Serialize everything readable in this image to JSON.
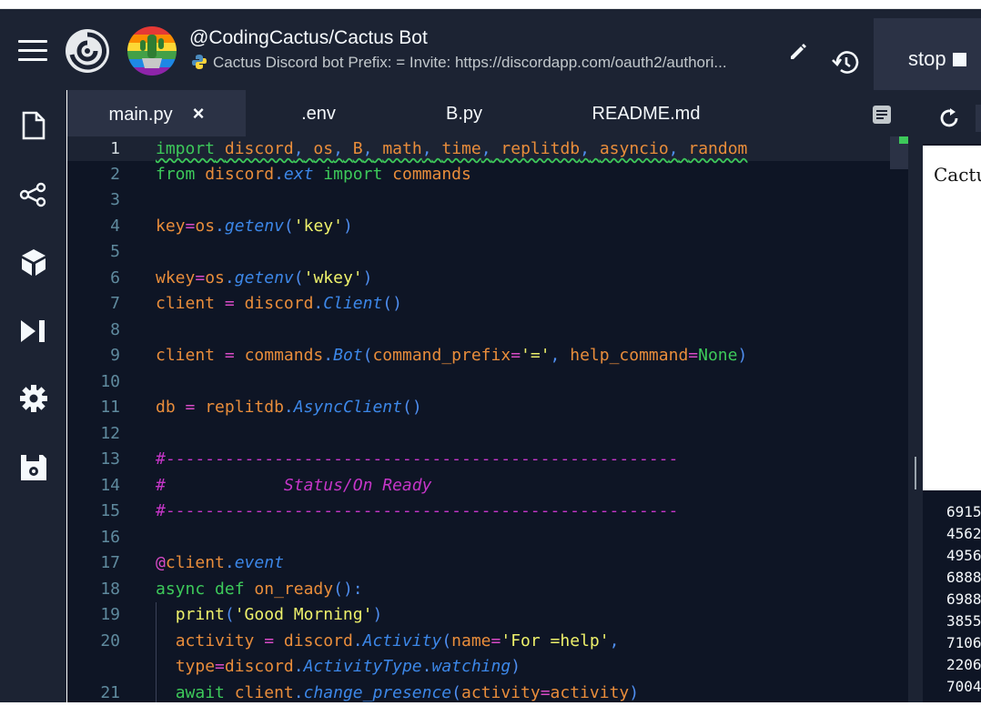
{
  "header": {
    "repo_title": "@CodingCactus/Cactus Bot",
    "description": "Cactus Discord bot Prefix: = Invite: https://discordapp.com/oauth2/authori...",
    "stop_label": "stop"
  },
  "sidebar": {
    "icons": [
      "file-icon",
      "share-icon",
      "packages-icon",
      "debugger-icon",
      "settings-icon",
      "database-icon"
    ]
  },
  "tabs": [
    {
      "label": "main.py",
      "active": true
    },
    {
      "label": ".env"
    },
    {
      "label": "B.py"
    },
    {
      "label": "README.md"
    }
  ],
  "close_glyph": "×",
  "line_numbers": [
    "1",
    "2",
    "3",
    "4",
    "5",
    "6",
    "7",
    "8",
    "9",
    "10",
    "11",
    "12",
    "13",
    "14",
    "15",
    "16",
    "17",
    "18",
    "19",
    "20",
    "21"
  ],
  "right_panel": {
    "webview_text": "Cactu",
    "console_lines": [
      "6915",
      "4562",
      "4956",
      "6888",
      "6988",
      "3855",
      "7106",
      "2206",
      "7004"
    ]
  },
  "colors": {
    "bg": "#0e1525",
    "panel": "#1c2333",
    "keyword": "#3dc95a",
    "identifier": "#e98d3b",
    "function": "#3c87e8",
    "string": "#eef16b",
    "comment": "#c536c8"
  },
  "code": {
    "l1": "import discord, os, B, math, time, replitdb, asyncio, random",
    "l2": "from discord.ext import commands",
    "l4": "key=os.getenv('key')",
    "l6": "wkey=os.getenv('wkey')",
    "l7": "client = discord.Client()",
    "l9": "client = commands.Bot(command_prefix='=', help_command=None)",
    "l11": "db = replitdb.AsyncClient()",
    "l13": "#----------------------------------------------------",
    "l14": "#            Status/On Ready",
    "l15": "#----------------------------------------------------",
    "l17": "@client.event",
    "l18": "async def on_ready():",
    "l19": "  print('Good Morning')",
    "l20a": "  activity = discord.Activity(name='For =help',",
    "l20b": "  type=discord.ActivityType.watching)",
    "l21": "  await client.change_presence(activity=activity)"
  }
}
